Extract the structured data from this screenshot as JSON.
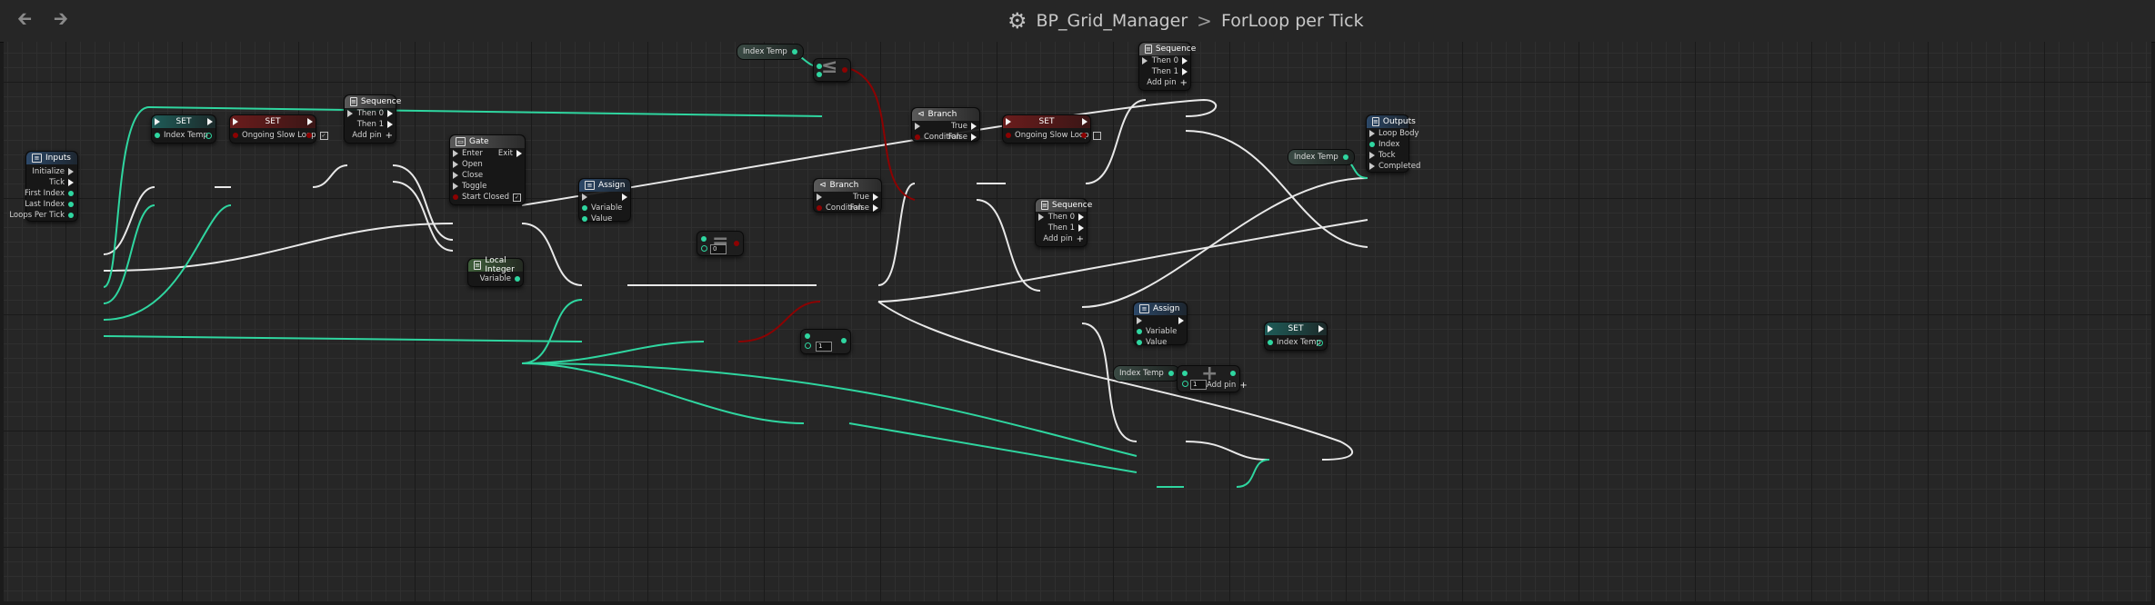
{
  "toolbar": {
    "back_icon": "arrow-left-icon",
    "forward_icon": "arrow-right-icon"
  },
  "breadcrumb": {
    "icon": "gear-icon",
    "blueprint": "BP_Grid_Manager",
    "separator": ">",
    "graph": "ForLoop per Tick"
  },
  "colors": {
    "exec": "#f2f2f2",
    "integer": "#2fd6a0",
    "boolean": "#8c0202"
  },
  "nodes": {
    "inputs": {
      "title": "Inputs",
      "pins": [
        "Initialize",
        "Tick",
        "First Index",
        "Last Index",
        "Loops Per Tick"
      ]
    },
    "set1": {
      "title": "SET",
      "pin": "Index Temp"
    },
    "set2": {
      "title": "SET",
      "pin": "Ongoing Slow Loop",
      "checked": true
    },
    "seq1": {
      "title": "Sequence",
      "then0": "Then 0",
      "then1": "Then 1",
      "add": "Add pin"
    },
    "gate": {
      "title": "Gate",
      "enter": "Enter",
      "exit": "Exit",
      "open": "Open",
      "close": "Close",
      "toggle": "Toggle",
      "start_closed": "Start Closed",
      "checked": true
    },
    "assign1": {
      "title": "Assign",
      "variable": "Variable",
      "value": "Value"
    },
    "local_int": {
      "title": "Local Integer",
      "variable": "Variable"
    },
    "index_temp_top": {
      "label": "Index Temp"
    },
    "cmp_value": "0",
    "branch1": {
      "title": "Branch",
      "cond": "Condition",
      "true": "True",
      "false": "False"
    },
    "branch2": {
      "title": "Branch",
      "cond": "Condition",
      "true": "True",
      "false": "False"
    },
    "set3": {
      "title": "SET",
      "pin": "Ongoing Slow Loop",
      "checked": false
    },
    "seq2": {
      "title": "Sequence",
      "then0": "Then 0",
      "then1": "Then 1",
      "add": "Add pin"
    },
    "seq3": {
      "title": "Sequence",
      "then0": "Then 0",
      "then1": "Then 1",
      "add": "Add pin"
    },
    "index_temp_right": {
      "label": "Index Temp"
    },
    "outputs": {
      "title": "Outputs",
      "pins": [
        "Loop Body",
        "Index",
        "Tock",
        "Completed"
      ]
    },
    "assign2": {
      "title": "Assign",
      "variable": "Variable",
      "value": "Value"
    },
    "set4": {
      "title": "SET",
      "pin": "Index Temp"
    },
    "index_temp_bottom": {
      "label": "Index Temp"
    },
    "int_literal_mid": "1",
    "add_node": {
      "value": "1",
      "add": "Add pin"
    }
  }
}
